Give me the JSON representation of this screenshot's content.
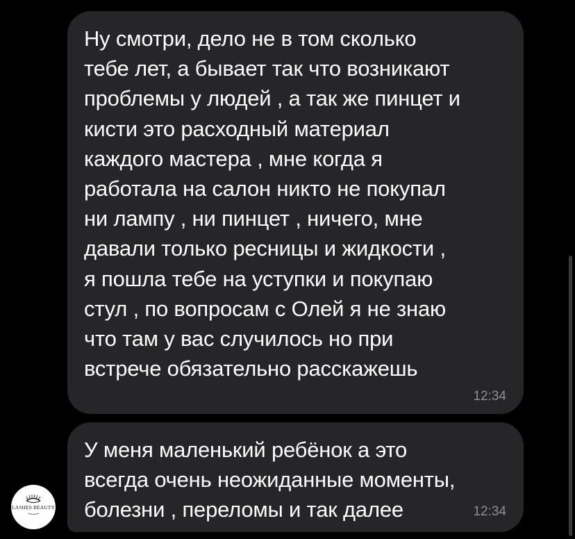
{
  "messages": [
    {
      "text": "Ну смотри, дело не в том сколько\nтебе лет, а бывает так что возникают\nпроблемы у людей , а так же пинцет и\nкисти это расходный материал\nкаждого мастера , мне когда я\nработала на салон никто не покупал\nни лампу , ни пинцет , ничего, мне\nдавали только ресницы и жидкости ,\nя пошла тебе на уступки и покупаю\nстул , по вопросам с Олей я не знаю\nчто там у вас случилось но при\nвстрече обязательно расскажешь",
      "time": "12:34"
    },
    {
      "text": "У меня маленький ребёнок а это\nвсегда очень неожиданные моменты,\nболезни , переломы и так далее",
      "time": "12:34"
    }
  ],
  "sender": {
    "avatar_text": "LASHES BEAUTY",
    "avatar_icon": "eye-lash-logo-icon"
  },
  "colors": {
    "background": "#000000",
    "bubble": "#262628",
    "text": "#ffffff",
    "time": "#8e8e93"
  }
}
